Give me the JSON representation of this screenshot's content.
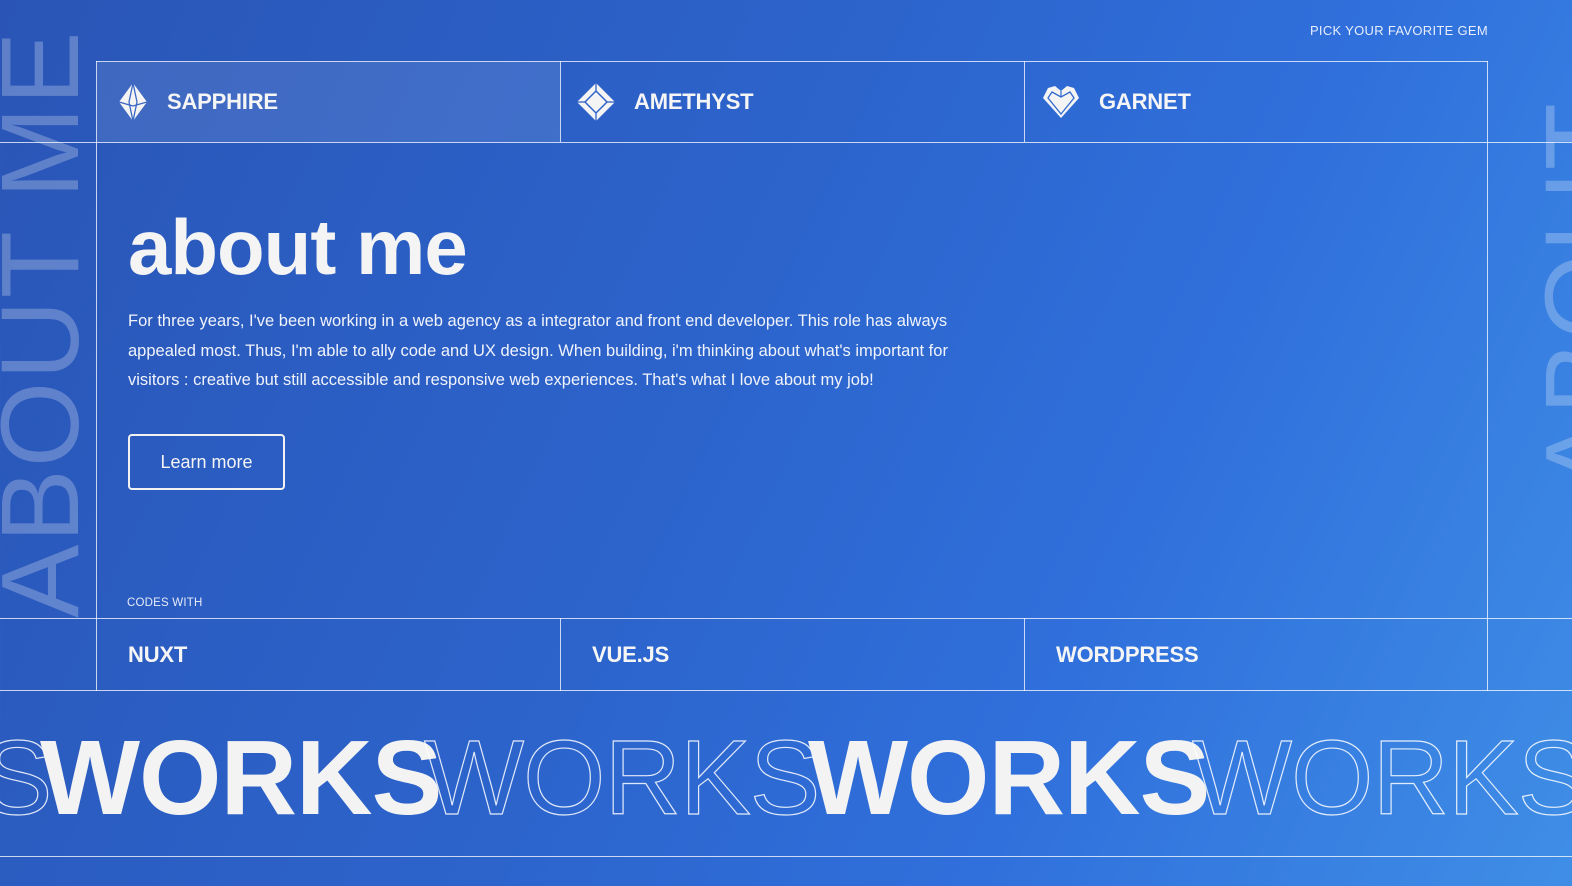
{
  "header": {
    "pick_label": "PICK YOUR FAVORITE GEM"
  },
  "gems": [
    {
      "label": "SAPPHIRE",
      "icon": "sapphire-icon",
      "active": true
    },
    {
      "label": "AMETHYST",
      "icon": "amethyst-icon",
      "active": false
    },
    {
      "label": "GARNET",
      "icon": "garnet-icon",
      "active": false
    }
  ],
  "side_text": {
    "left": "ABOUT ME",
    "right": "ABOUT"
  },
  "main": {
    "title": "about me",
    "intro": "For three years, I've been working in a web agency as a integrator and front end developer. This role has always appealed most. Thus, I'm able to ally code and UX design. When building, i'm thinking about what's important for visitors : creative but still accessible and responsive web experiences. That's what I love about my job!",
    "learn_more": "Learn more"
  },
  "codes": {
    "label": "CODES WITH",
    "items": [
      "NUXT",
      "VUE.JS",
      "WORDPRESS"
    ]
  },
  "marquee": {
    "word": "WORKS"
  },
  "colors": {
    "background_start": "#2a55b6",
    "background_end": "#3f8ee6",
    "text": "#f2f2f2"
  }
}
